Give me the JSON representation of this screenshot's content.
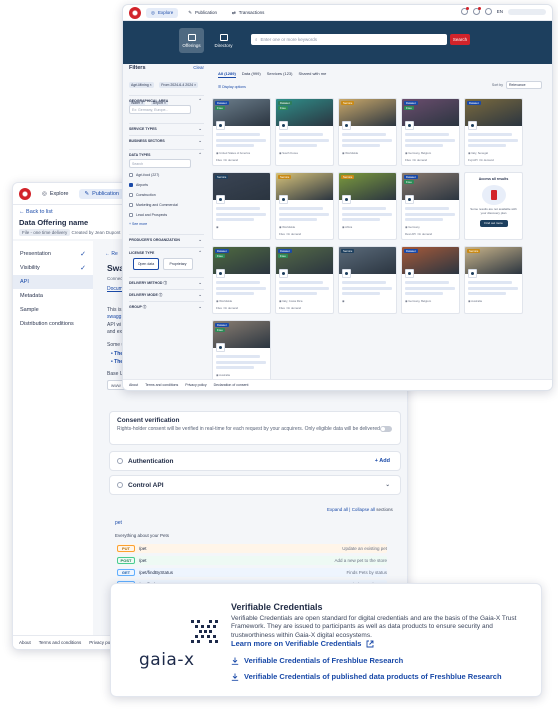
{
  "back_window": {
    "nav": [
      {
        "label": "Explore"
      },
      {
        "label": "Publication"
      }
    ],
    "back_link": "Back to list",
    "title": "Data Offering name",
    "subtitle_tag": "File - one time delivery",
    "subtitle_created": "Created by Jean Dupont",
    "sidebar": [
      {
        "label": "Presentation",
        "done": true
      },
      {
        "label": "Visibility",
        "done": true
      },
      {
        "label": "API",
        "done": false
      },
      {
        "label": "Metadata",
        "done": false
      },
      {
        "label": "Sample",
        "done": false
      },
      {
        "label": "Distribution conditions",
        "done": false
      }
    ],
    "main": {
      "back_snippet": "Re",
      "heading_snippet": "Swa",
      "sub_snippet": "Connec",
      "link_snippet": "Docum",
      "para_lines": [
        "This is",
        "swagg",
        "API wi",
        "and ex"
      ],
      "some_snippet": "Some u",
      "bullets": [
        "The",
        "The"
      ],
      "base_snippet": "Base U",
      "input_snippet": "www"
    },
    "consent": {
      "title": "Consent verification",
      "desc": "Rights-holder consent will be verified in real-time for each request by your acquirers. Only eligible data will be delivered."
    },
    "authentication": {
      "title": "Authentication",
      "add_label": "Add"
    },
    "control_api": {
      "title": "Control API"
    },
    "api_ops": {
      "expand_all": "Expand all",
      "collapse_all": "Collapse all",
      "sections": "sections",
      "group": "pet",
      "group_desc": "Everything about your Pets",
      "rows": [
        {
          "method": "PUT",
          "path": "/pet",
          "desc": "Update an existing pet",
          "color": "#fca130"
        },
        {
          "method": "POST",
          "path": "/pet",
          "desc": "Add a new pet to the store",
          "color": "#49cc90"
        },
        {
          "method": "GET",
          "path": "/pet/findByStatus",
          "desc": "Finds Pets by status",
          "color": "#61affe"
        },
        {
          "method": "GET",
          "path": "/pet/findByTags",
          "desc": "Finds Pets by tags",
          "color": "#61affe"
        }
      ]
    },
    "footer": [
      "About",
      "Terms and conditions",
      "Privacy policy",
      "Declar"
    ]
  },
  "front_window": {
    "nav": [
      {
        "label": "Explore"
      },
      {
        "label": "Publication"
      },
      {
        "label": "Transactions"
      }
    ],
    "lang": "EN",
    "hero": {
      "offerings": "Offerings",
      "directory": "Directory",
      "search_placeholder": "Enter one or more keywords",
      "search_btn": "Search"
    },
    "filters": {
      "title": "Filters",
      "clear": "Clear",
      "chips": [
        "Agri-Mining",
        "From 2024-6-4 2024",
        "Water",
        "Airport"
      ],
      "geo": "GEOGRAPHICAL AREA",
      "geo_placeholder": "Ex: Germany, Europe...",
      "service_types": "SERVICE TYPES",
      "business_sectors": "BUSINESS SECTORS",
      "data_types": "DATA TYPES",
      "data_search": "Search",
      "options": [
        {
          "label": "Agri-food (227)",
          "checked": false
        },
        {
          "label": "Airports",
          "checked": true
        },
        {
          "label": "Construction",
          "checked": false
        },
        {
          "label": "Marketing and Commercial",
          "checked": false
        },
        {
          "label": "Lead and Prospects",
          "checked": false
        }
      ],
      "see_more": "See more",
      "producers": "PRODUCER'S ORGANIZATION",
      "license": "LICENSE TYPE",
      "license_opts": [
        "Open data",
        "Proprietary"
      ],
      "delivery_method": "DELIVERY METHOD",
      "delivery_mode": "DELIVERY MODE",
      "group": "GROUP"
    },
    "tabs": [
      "All (1289)",
      "Data (999)",
      "Services (123)",
      "Shared with me"
    ],
    "display_options": "Display options",
    "sort_label": "Sort by",
    "sort_value": "Relevance",
    "cards": [
      {
        "tag": "Dataset",
        "tag2": "Free",
        "tag_color": "#1a4aa8",
        "img": "#6c7e8c",
        "loc": "United States of America",
        "l1": "Files",
        "l2": "On demand"
      },
      {
        "tag": "Dataset",
        "tag2": "Free",
        "tag_color": "#2e7d5b",
        "img": "#2f8f8a",
        "loc": "South Korea",
        "l1": "",
        "l2": ""
      },
      {
        "tag": "Service",
        "tag2": "",
        "tag_color": "#c98a16",
        "img": "#c9a86a",
        "loc": "Worldwide",
        "l1": "",
        "l2": ""
      },
      {
        "tag": "Dataset",
        "tag2": "Free",
        "tag_color": "#1a4aa8",
        "img": "#6b4d6e",
        "loc": "Germany, Belgium",
        "l1": "Files",
        "l2": "On demand"
      },
      {
        "tag": "Dataset",
        "tag2": "",
        "tag_color": "#1a4aa8",
        "img": "#7a6a3e",
        "loc": "Italy, Senegal",
        "l1": "Fuji API",
        "l2": "On demand"
      },
      {
        "tag": "Service",
        "tag2": "",
        "tag_color": "#1d3f5e",
        "img": "#3a4454",
        "loc": "",
        "l1": "",
        "l2": ""
      },
      {
        "tag": "Service",
        "tag2": "",
        "tag_color": "#c98a16",
        "img": "#d6c27a",
        "loc": "Worldwide",
        "l1": "Files",
        "l2": "On demand"
      },
      {
        "tag": "Service",
        "tag2": "",
        "tag_color": "#c98a16",
        "img": "#7b9a3e",
        "loc": "Africa",
        "l1": "",
        "l2": ""
      },
      {
        "tag": "Dataset",
        "tag2": "Free",
        "tag_color": "#1a4aa8",
        "img": "#8a7a6e",
        "loc": "Germany",
        "l1": "Rest API",
        "l2": "On demand"
      },
      {
        "tag": "Dataset",
        "tag2": "Free",
        "tag_color": "#1a4aa8",
        "img": "#4f6a40",
        "loc": "Worldwide",
        "l1": "Files",
        "l2": "On demand"
      },
      {
        "tag": "Dataset",
        "tag2": "Free",
        "tag_color": "#1a4aa8",
        "img": "#556b47",
        "loc": "Italy, Costa Rica",
        "l1": "Files",
        "l2": "On demand"
      },
      {
        "tag": "Service",
        "tag2": "",
        "tag_color": "#1d3f5e",
        "img": "#5a6a7a",
        "loc": "",
        "l1": "",
        "l2": ""
      },
      {
        "tag": "Dataset",
        "tag2": "",
        "tag_color": "#1a4aa8",
        "img": "#a65a3a",
        "loc": "Germany, Belgium",
        "l1": "",
        "l2": ""
      },
      {
        "tag": "Service",
        "tag2": "",
        "tag_color": "#c98a16",
        "img": "#c9b48a",
        "loc": "Australia",
        "l1": "",
        "l2": ""
      },
      {
        "tag": "Dataset",
        "tag2": "Free",
        "tag_color": "#1a4aa8",
        "img": "#8a7e72",
        "loc": "Australia",
        "l1": "",
        "l2": ""
      }
    ],
    "access_card": {
      "title": "Access all results",
      "desc": "Some results are not available with your discovery plan",
      "button": "Find out more"
    },
    "footer": [
      "About",
      "Terms and conditions",
      "Privacy policy",
      "Declaration of consent"
    ]
  },
  "gaia": {
    "logo_text": "gaia-x",
    "title": "Verifiable Credentials",
    "desc": "Verifiable Credentials are open standard for digital credentials and are the basis of the Gaia-X Trust Framework. They are issued to participants as well as data products to ensure security and trustworthiness within Gaia-X digital ecosystems.",
    "learn_more": "Learn more on Verifiable Credentials",
    "link1": "Verifiable Credentials of Freshblue Research",
    "link2": "Verifiable Credentials of published data products of Freshblue Research",
    "brand_color": "#1a4aa8"
  }
}
